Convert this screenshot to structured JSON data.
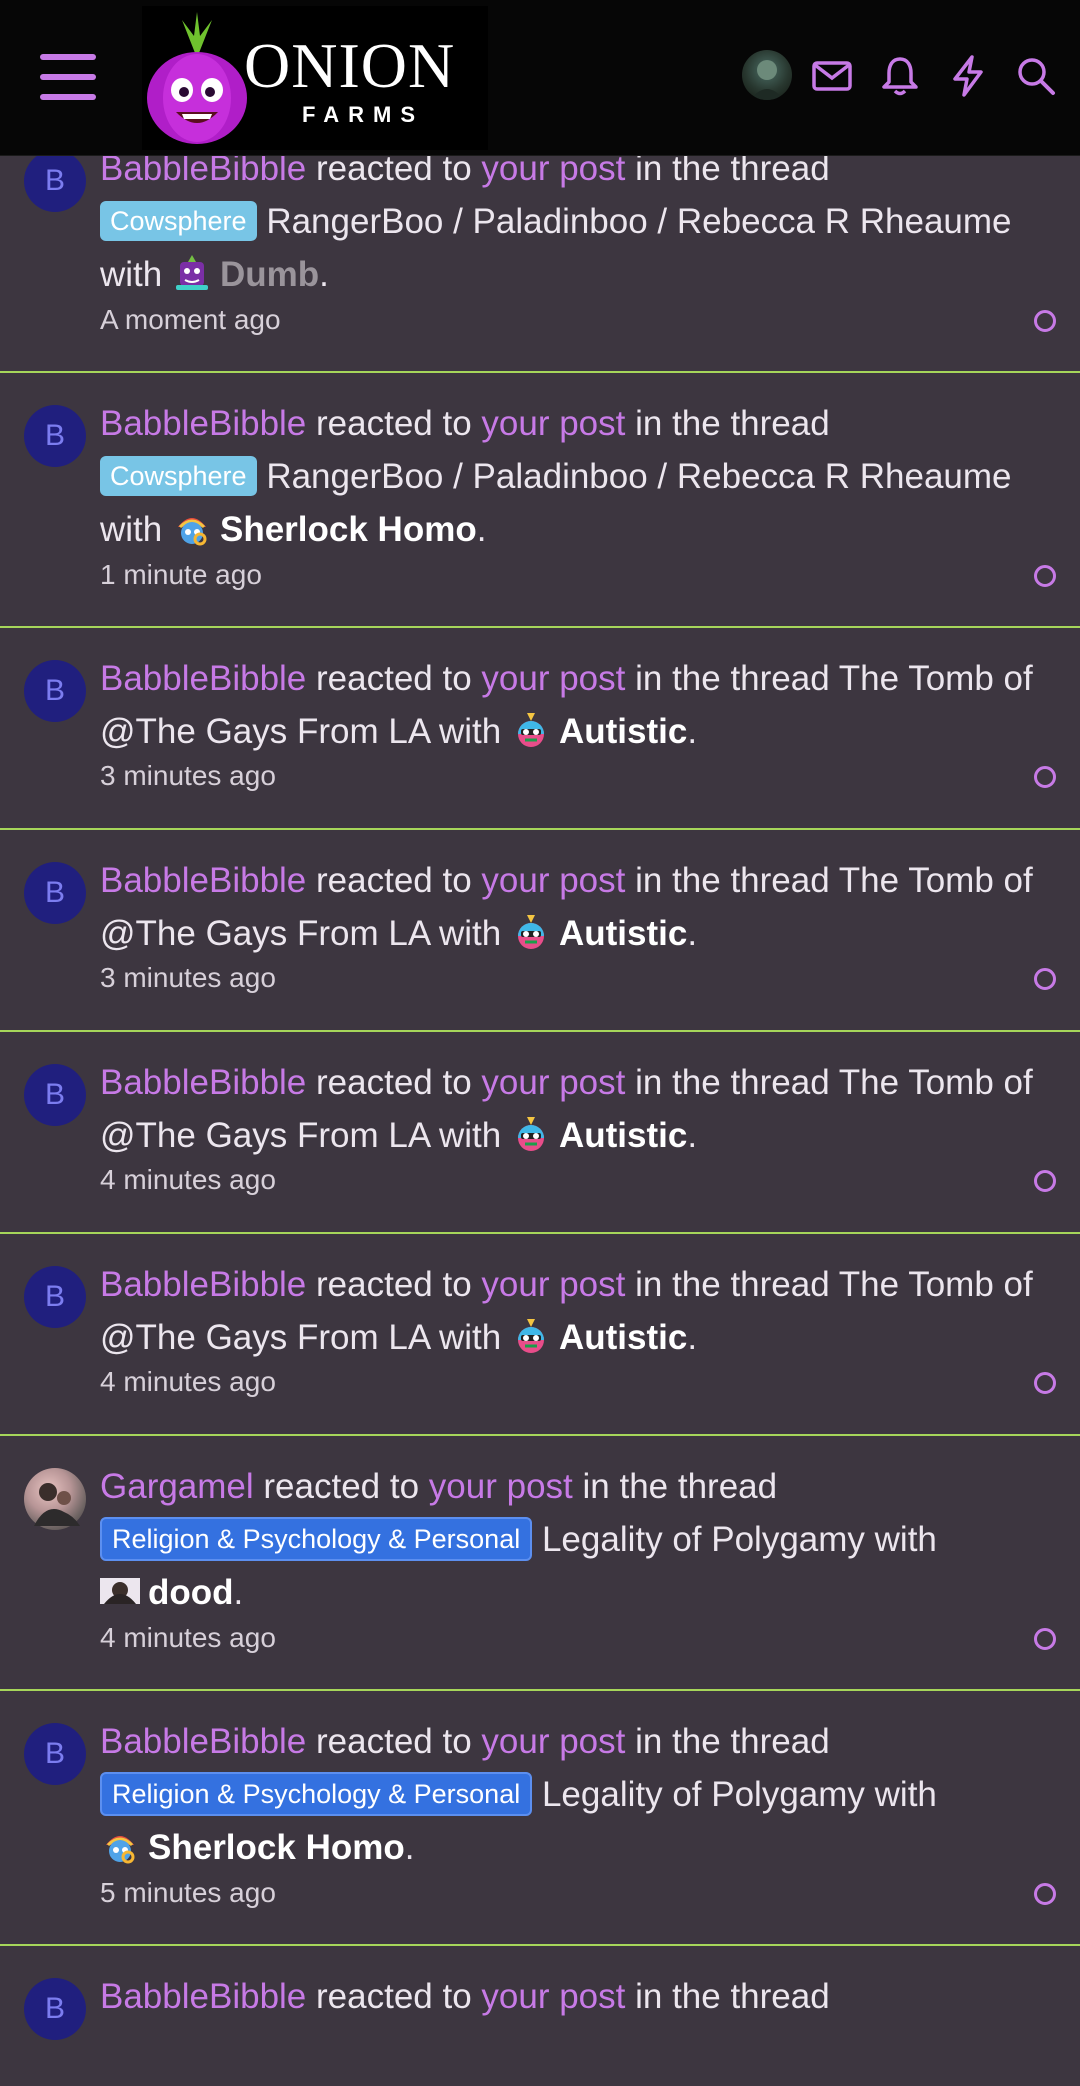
{
  "header": {
    "logo_word": "ONION",
    "logo_sub": "FARMS"
  },
  "items": [
    {
      "user": "BabbleBibble",
      "avatar_letter": "B",
      "verb": "reacted to",
      "link": "your post",
      "mid": "in the thread",
      "tag": "Cowsphere",
      "tag_style": "cow",
      "thread": "RangerBoo / Paladinboo / Rebecca R Rheaume",
      "with": "with",
      "reaction": "Dumb",
      "time": "A moment ago"
    },
    {
      "user": "BabbleBibble",
      "avatar_letter": "B",
      "verb": "reacted to",
      "link": "your post",
      "mid": "in the thread",
      "tag": "Cowsphere",
      "tag_style": "cow",
      "thread": "RangerBoo / Paladinboo / Rebecca R Rheaume",
      "with": "with",
      "reaction": "Sherlock Homo",
      "time": "1 minute ago"
    },
    {
      "user": "BabbleBibble",
      "avatar_letter": "B",
      "verb": "reacted to",
      "link": "your post",
      "mid": "in the thread",
      "tag": "",
      "thread": "The Tomb of @The Gays From LA",
      "with": "with",
      "reaction": "Autistic",
      "time": "3 minutes ago"
    },
    {
      "user": "BabbleBibble",
      "avatar_letter": "B",
      "verb": "reacted to",
      "link": "your post",
      "mid": "in the thread",
      "tag": "",
      "thread": "The Tomb of @The Gays From LA",
      "with": "with",
      "reaction": "Autistic",
      "time": "3 minutes ago"
    },
    {
      "user": "BabbleBibble",
      "avatar_letter": "B",
      "verb": "reacted to",
      "link": "your post",
      "mid": "in the thread",
      "tag": "",
      "thread": "The Tomb of @The Gays From LA",
      "with": "with",
      "reaction": "Autistic",
      "time": "4 minutes ago"
    },
    {
      "user": "BabbleBibble",
      "avatar_letter": "B",
      "verb": "reacted to",
      "link": "your post",
      "mid": "in the thread",
      "tag": "",
      "thread": "The Tomb of @The Gays From LA",
      "with": "with",
      "reaction": "Autistic",
      "time": "4 minutes ago"
    },
    {
      "user": "Gargamel",
      "avatar_letter": "",
      "verb": "reacted to",
      "link": "your post",
      "mid": "in the thread",
      "tag": "Religion & Psychology & Personal",
      "tag_style": "rel",
      "thread": "Legality of Polygamy",
      "with": "with",
      "reaction": "dood",
      "time": "4 minutes ago"
    },
    {
      "user": "BabbleBibble",
      "avatar_letter": "B",
      "verb": "reacted to",
      "link": "your post",
      "mid": "in the thread",
      "tag": "Religion & Psychology & Personal",
      "tag_style": "rel",
      "thread": "Legality of Polygamy",
      "with": "with",
      "reaction": "Sherlock Homo",
      "time": "5 minutes ago"
    },
    {
      "user": "BabbleBibble",
      "avatar_letter": "B",
      "verb": "reacted to",
      "link": "your post",
      "mid": "in the thread",
      "tag": "",
      "thread": "",
      "with": "",
      "reaction": "",
      "time": ""
    }
  ]
}
